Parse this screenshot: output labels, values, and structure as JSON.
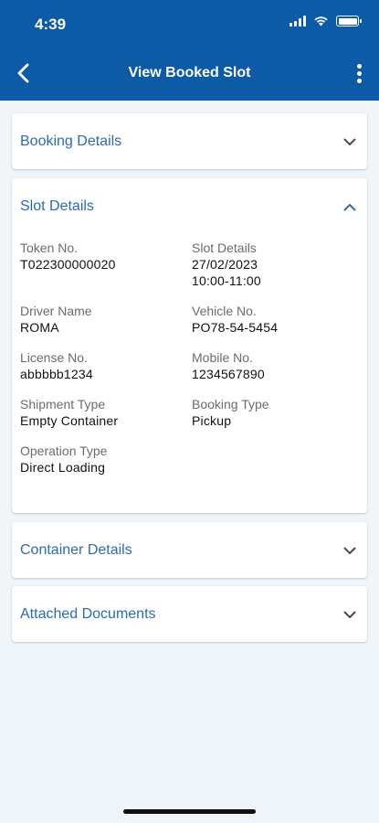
{
  "status_bar": {
    "time": "4:39"
  },
  "header": {
    "title": "View Booked Slot"
  },
  "sections": {
    "booking": {
      "title": "Booking Details"
    },
    "slot": {
      "title": "Slot Details",
      "fields": {
        "token_label": "Token No.",
        "token_value": "T022300000020",
        "slot_label": "Slot Details",
        "slot_date": "27/02/2023",
        "slot_time": "10:00-11:00",
        "driver_label": "Driver Name",
        "driver_value": "ROMA",
        "vehicle_label": "Vehicle No.",
        "vehicle_value": "PO78-54-5454",
        "license_label": "License No.",
        "license_value": "abbbbb1234",
        "mobile_label": "Mobile No.",
        "mobile_value": "1234567890",
        "shipment_label": "Shipment Type",
        "shipment_value": "Empty Container",
        "booking_type_label": "Booking Type",
        "booking_type_value": "Pickup",
        "operation_label": "Operation Type",
        "operation_value": "Direct Loading"
      }
    },
    "container": {
      "title": "Container Details"
    },
    "documents": {
      "title": "Attached Documents"
    }
  },
  "colors": {
    "appbar": "#0d5aa7",
    "section_title": "#2c6bb0",
    "background": "#f0f5fa"
  },
  "icons": {
    "back": "chevron-left-icon",
    "more": "more-vertical-icon",
    "expand": "chevron-down-icon",
    "collapse": "chevron-up-icon"
  }
}
